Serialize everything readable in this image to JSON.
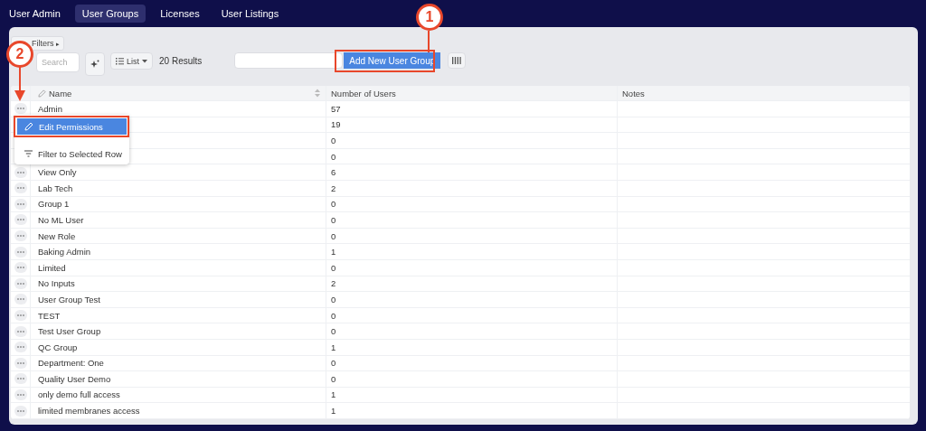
{
  "nav": {
    "tabs": [
      {
        "label": "User Admin",
        "selected": false
      },
      {
        "label": "User Groups",
        "selected": true
      },
      {
        "label": "Licenses",
        "selected": false
      },
      {
        "label": "User Listings",
        "selected": false
      }
    ]
  },
  "toolbar": {
    "filters": "Filters",
    "filters_caret": "▸",
    "search": {
      "placeholder": "Search"
    },
    "view": "List",
    "results": "20 Results",
    "add_button": "Add New User Group"
  },
  "table": {
    "columns": [
      "Name",
      "Number of Users",
      "Notes"
    ],
    "rows": [
      {
        "name": "Admin",
        "users": "57"
      },
      {
        "users": "19"
      },
      {
        "users": "0"
      },
      {
        "users": "0"
      },
      {
        "name": "View Only",
        "users": "6"
      },
      {
        "name": "Lab Tech",
        "users": "2"
      },
      {
        "name": "Group 1",
        "users": "0"
      },
      {
        "name": "No ML User",
        "users": "0"
      },
      {
        "name": "New Role",
        "users": "0"
      },
      {
        "name": "Baking Admin",
        "users": "1"
      },
      {
        "name": "Limited",
        "users": "0"
      },
      {
        "name": "No Inputs",
        "users": "2"
      },
      {
        "name": "User Group Test",
        "users": "0"
      },
      {
        "name": "TEST",
        "users": "0"
      },
      {
        "name": "Test User Group",
        "users": "0"
      },
      {
        "name": "QC Group",
        "users": "1"
      },
      {
        "name": "Department: One",
        "users": "0"
      },
      {
        "name": "Quality User Demo",
        "users": "0"
      },
      {
        "name": "only demo full access",
        "users": "1"
      },
      {
        "name": "limited membranes access",
        "users": "1"
      }
    ]
  },
  "row_menu": {
    "items": [
      {
        "kind": "edit",
        "label": "Edit Permissions",
        "selected": true
      },
      {
        "kind": "filter",
        "label": "Filter to Selected Row",
        "selected": false
      }
    ]
  },
  "annotations": [
    {
      "label": "1"
    },
    {
      "label": "2"
    }
  ]
}
